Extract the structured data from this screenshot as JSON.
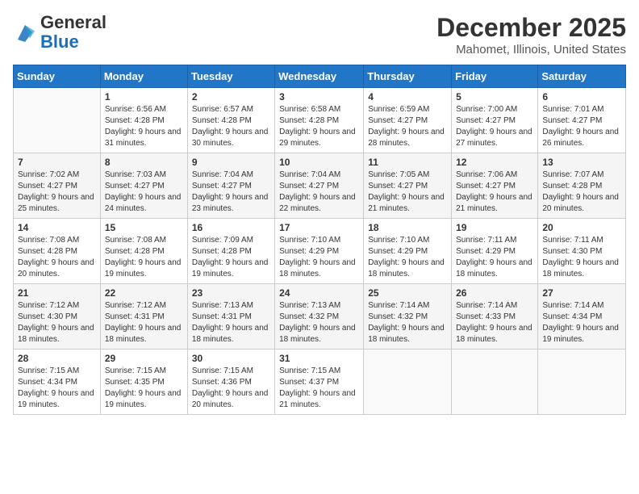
{
  "header": {
    "logo_line1": "General",
    "logo_line2": "Blue",
    "month_year": "December 2025",
    "location": "Mahomet, Illinois, United States"
  },
  "weekdays": [
    "Sunday",
    "Monday",
    "Tuesday",
    "Wednesday",
    "Thursday",
    "Friday",
    "Saturday"
  ],
  "weeks": [
    [
      {
        "day": "",
        "sunrise": "",
        "sunset": "",
        "daylight": ""
      },
      {
        "day": "1",
        "sunrise": "Sunrise: 6:56 AM",
        "sunset": "Sunset: 4:28 PM",
        "daylight": "Daylight: 9 hours and 31 minutes."
      },
      {
        "day": "2",
        "sunrise": "Sunrise: 6:57 AM",
        "sunset": "Sunset: 4:28 PM",
        "daylight": "Daylight: 9 hours and 30 minutes."
      },
      {
        "day": "3",
        "sunrise": "Sunrise: 6:58 AM",
        "sunset": "Sunset: 4:28 PM",
        "daylight": "Daylight: 9 hours and 29 minutes."
      },
      {
        "day": "4",
        "sunrise": "Sunrise: 6:59 AM",
        "sunset": "Sunset: 4:27 PM",
        "daylight": "Daylight: 9 hours and 28 minutes."
      },
      {
        "day": "5",
        "sunrise": "Sunrise: 7:00 AM",
        "sunset": "Sunset: 4:27 PM",
        "daylight": "Daylight: 9 hours and 27 minutes."
      },
      {
        "day": "6",
        "sunrise": "Sunrise: 7:01 AM",
        "sunset": "Sunset: 4:27 PM",
        "daylight": "Daylight: 9 hours and 26 minutes."
      }
    ],
    [
      {
        "day": "7",
        "sunrise": "Sunrise: 7:02 AM",
        "sunset": "Sunset: 4:27 PM",
        "daylight": "Daylight: 9 hours and 25 minutes."
      },
      {
        "day": "8",
        "sunrise": "Sunrise: 7:03 AM",
        "sunset": "Sunset: 4:27 PM",
        "daylight": "Daylight: 9 hours and 24 minutes."
      },
      {
        "day": "9",
        "sunrise": "Sunrise: 7:04 AM",
        "sunset": "Sunset: 4:27 PM",
        "daylight": "Daylight: 9 hours and 23 minutes."
      },
      {
        "day": "10",
        "sunrise": "Sunrise: 7:04 AM",
        "sunset": "Sunset: 4:27 PM",
        "daylight": "Daylight: 9 hours and 22 minutes."
      },
      {
        "day": "11",
        "sunrise": "Sunrise: 7:05 AM",
        "sunset": "Sunset: 4:27 PM",
        "daylight": "Daylight: 9 hours and 21 minutes."
      },
      {
        "day": "12",
        "sunrise": "Sunrise: 7:06 AM",
        "sunset": "Sunset: 4:27 PM",
        "daylight": "Daylight: 9 hours and 21 minutes."
      },
      {
        "day": "13",
        "sunrise": "Sunrise: 7:07 AM",
        "sunset": "Sunset: 4:28 PM",
        "daylight": "Daylight: 9 hours and 20 minutes."
      }
    ],
    [
      {
        "day": "14",
        "sunrise": "Sunrise: 7:08 AM",
        "sunset": "Sunset: 4:28 PM",
        "daylight": "Daylight: 9 hours and 20 minutes."
      },
      {
        "day": "15",
        "sunrise": "Sunrise: 7:08 AM",
        "sunset": "Sunset: 4:28 PM",
        "daylight": "Daylight: 9 hours and 19 minutes."
      },
      {
        "day": "16",
        "sunrise": "Sunrise: 7:09 AM",
        "sunset": "Sunset: 4:28 PM",
        "daylight": "Daylight: 9 hours and 19 minutes."
      },
      {
        "day": "17",
        "sunrise": "Sunrise: 7:10 AM",
        "sunset": "Sunset: 4:29 PM",
        "daylight": "Daylight: 9 hours and 18 minutes."
      },
      {
        "day": "18",
        "sunrise": "Sunrise: 7:10 AM",
        "sunset": "Sunset: 4:29 PM",
        "daylight": "Daylight: 9 hours and 18 minutes."
      },
      {
        "day": "19",
        "sunrise": "Sunrise: 7:11 AM",
        "sunset": "Sunset: 4:29 PM",
        "daylight": "Daylight: 9 hours and 18 minutes."
      },
      {
        "day": "20",
        "sunrise": "Sunrise: 7:11 AM",
        "sunset": "Sunset: 4:30 PM",
        "daylight": "Daylight: 9 hours and 18 minutes."
      }
    ],
    [
      {
        "day": "21",
        "sunrise": "Sunrise: 7:12 AM",
        "sunset": "Sunset: 4:30 PM",
        "daylight": "Daylight: 9 hours and 18 minutes."
      },
      {
        "day": "22",
        "sunrise": "Sunrise: 7:12 AM",
        "sunset": "Sunset: 4:31 PM",
        "daylight": "Daylight: 9 hours and 18 minutes."
      },
      {
        "day": "23",
        "sunrise": "Sunrise: 7:13 AM",
        "sunset": "Sunset: 4:31 PM",
        "daylight": "Daylight: 9 hours and 18 minutes."
      },
      {
        "day": "24",
        "sunrise": "Sunrise: 7:13 AM",
        "sunset": "Sunset: 4:32 PM",
        "daylight": "Daylight: 9 hours and 18 minutes."
      },
      {
        "day": "25",
        "sunrise": "Sunrise: 7:14 AM",
        "sunset": "Sunset: 4:32 PM",
        "daylight": "Daylight: 9 hours and 18 minutes."
      },
      {
        "day": "26",
        "sunrise": "Sunrise: 7:14 AM",
        "sunset": "Sunset: 4:33 PM",
        "daylight": "Daylight: 9 hours and 18 minutes."
      },
      {
        "day": "27",
        "sunrise": "Sunrise: 7:14 AM",
        "sunset": "Sunset: 4:34 PM",
        "daylight": "Daylight: 9 hours and 19 minutes."
      }
    ],
    [
      {
        "day": "28",
        "sunrise": "Sunrise: 7:15 AM",
        "sunset": "Sunset: 4:34 PM",
        "daylight": "Daylight: 9 hours and 19 minutes."
      },
      {
        "day": "29",
        "sunrise": "Sunrise: 7:15 AM",
        "sunset": "Sunset: 4:35 PM",
        "daylight": "Daylight: 9 hours and 19 minutes."
      },
      {
        "day": "30",
        "sunrise": "Sunrise: 7:15 AM",
        "sunset": "Sunset: 4:36 PM",
        "daylight": "Daylight: 9 hours and 20 minutes."
      },
      {
        "day": "31",
        "sunrise": "Sunrise: 7:15 AM",
        "sunset": "Sunset: 4:37 PM",
        "daylight": "Daylight: 9 hours and 21 minutes."
      },
      {
        "day": "",
        "sunrise": "",
        "sunset": "",
        "daylight": ""
      },
      {
        "day": "",
        "sunrise": "",
        "sunset": "",
        "daylight": ""
      },
      {
        "day": "",
        "sunrise": "",
        "sunset": "",
        "daylight": ""
      }
    ]
  ]
}
